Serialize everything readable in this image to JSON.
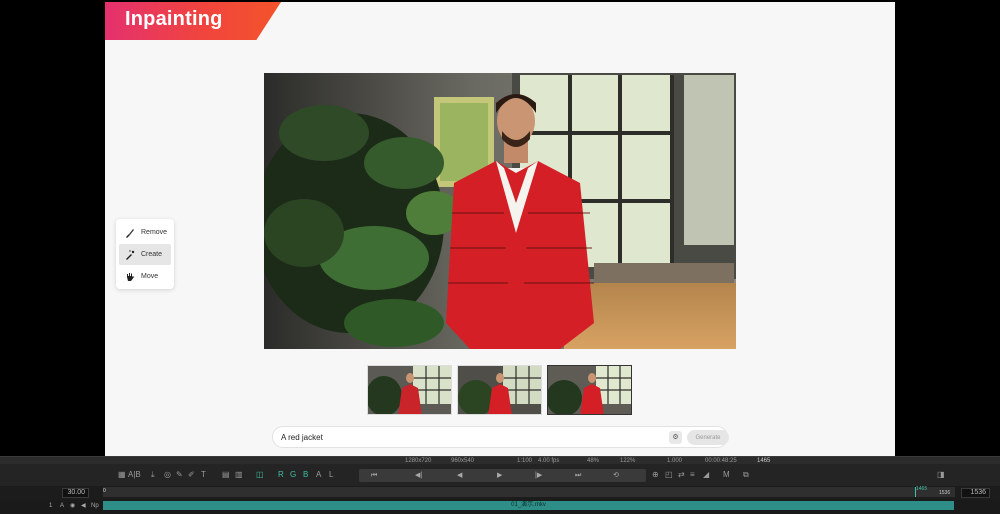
{
  "app": {
    "title": "Inpainting"
  },
  "tools": [
    {
      "label": "Remove",
      "icon": "brush-icon",
      "active": false
    },
    {
      "label": "Create",
      "icon": "magic-brush-icon",
      "active": true
    },
    {
      "label": "Move",
      "icon": "hand-icon",
      "active": false
    }
  ],
  "prompt": {
    "value": "A red jacket",
    "generate_label": "Generate"
  },
  "thumbnails": [
    {
      "name": "variant-1",
      "selected": false
    },
    {
      "name": "variant-2",
      "selected": false
    },
    {
      "name": "variant-3",
      "selected": true
    }
  ],
  "player": {
    "status": {
      "resolution": "1280x720",
      "display": "960x540",
      "fps_ratio": "1:100",
      "fps": "4.00 fps",
      "volume": "48%",
      "zoom": "122%",
      "ratio": "1.000",
      "timecode": "00:00:48:25",
      "frame": "1465"
    },
    "toolbar": {
      "ab_label": "A|B",
      "text_tool": "T",
      "channels": [
        "R",
        "G",
        "B",
        "A",
        "L"
      ],
      "m_label": "M"
    },
    "timeline": {
      "fps_box": "30.00",
      "start_frame": "0",
      "current_marker": "1465",
      "end_marker": "1536",
      "end_box": "1536"
    },
    "track": {
      "number": "1",
      "a_label": "A",
      "np_label": "Np",
      "clip_name": "01_演示.mkv"
    }
  }
}
